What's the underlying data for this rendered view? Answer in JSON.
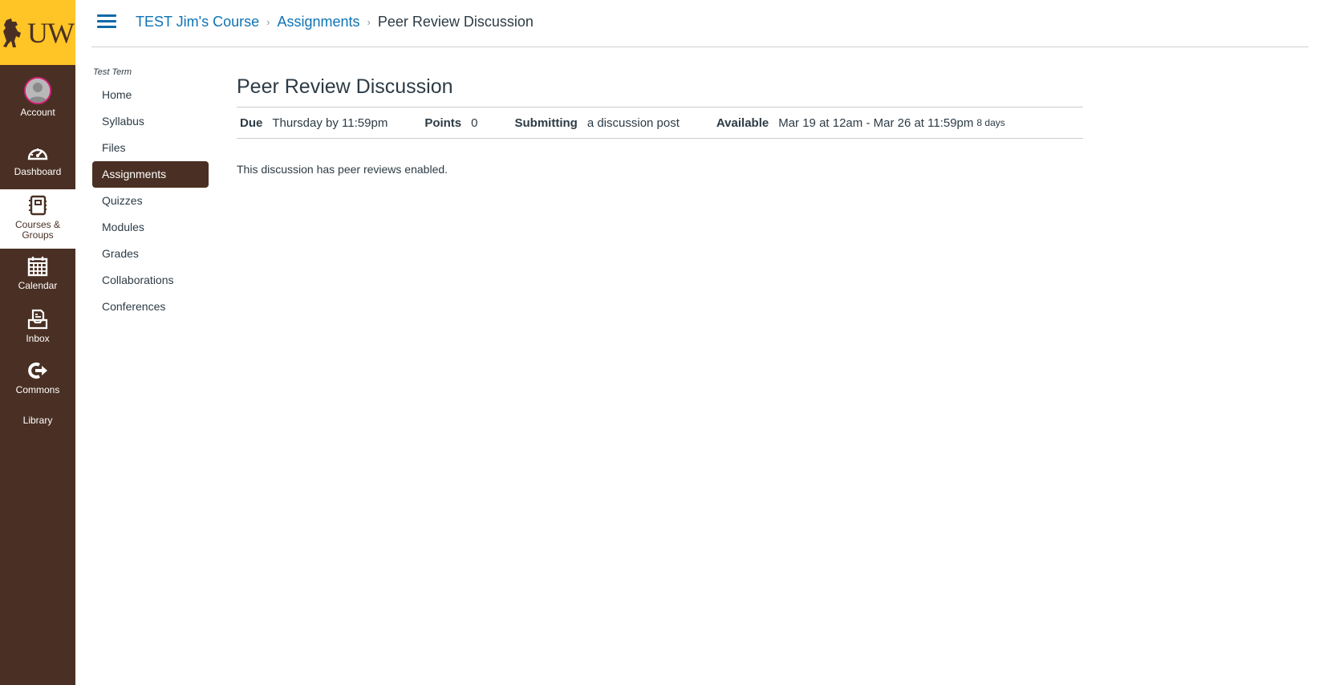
{
  "brand": {
    "logo_text": "UW",
    "colors": {
      "gold": "#ffc425",
      "brown": "#4a3024",
      "link": "#0e74b5",
      "avatar_ring": "#d6237a"
    }
  },
  "global_nav": {
    "items": [
      {
        "label": "Account",
        "icon": "avatar-icon"
      },
      {
        "label": "Dashboard",
        "icon": "speedometer-icon"
      },
      {
        "label": "Courses &",
        "label2": "Groups",
        "icon": "notebook-icon",
        "active": true
      },
      {
        "label": "Calendar",
        "icon": "calendar-icon"
      },
      {
        "label": "Inbox",
        "icon": "inbox-icon"
      },
      {
        "label": "Commons",
        "icon": "commons-icon"
      },
      {
        "label": "Library",
        "icon": ""
      }
    ]
  },
  "header": {
    "menu_icon": "hamburger-icon",
    "breadcrumb": [
      {
        "label": "TEST Jim's Course",
        "link": true
      },
      {
        "label": "Assignments",
        "link": true
      },
      {
        "label": "Peer Review Discussion",
        "link": false
      }
    ],
    "separator": "›"
  },
  "course_nav": {
    "term": "Test Term",
    "items": [
      {
        "label": "Home"
      },
      {
        "label": "Syllabus"
      },
      {
        "label": "Files"
      },
      {
        "label": "Assignments",
        "active": true
      },
      {
        "label": "Quizzes"
      },
      {
        "label": "Modules"
      },
      {
        "label": "Grades"
      },
      {
        "label": "Collaborations"
      },
      {
        "label": "Conferences"
      }
    ]
  },
  "assignment": {
    "title": "Peer Review Discussion",
    "details": {
      "due_label": "Due",
      "due_value": "Thursday by 11:59pm",
      "points_label": "Points",
      "points_value": "0",
      "submitting_label": "Submitting",
      "submitting_value": "a discussion post",
      "available_label": "Available",
      "available_value": "Mar 19 at 12am - Mar 26 at 11:59pm",
      "available_duration": "8 days"
    },
    "body": "This discussion has peer reviews enabled."
  }
}
